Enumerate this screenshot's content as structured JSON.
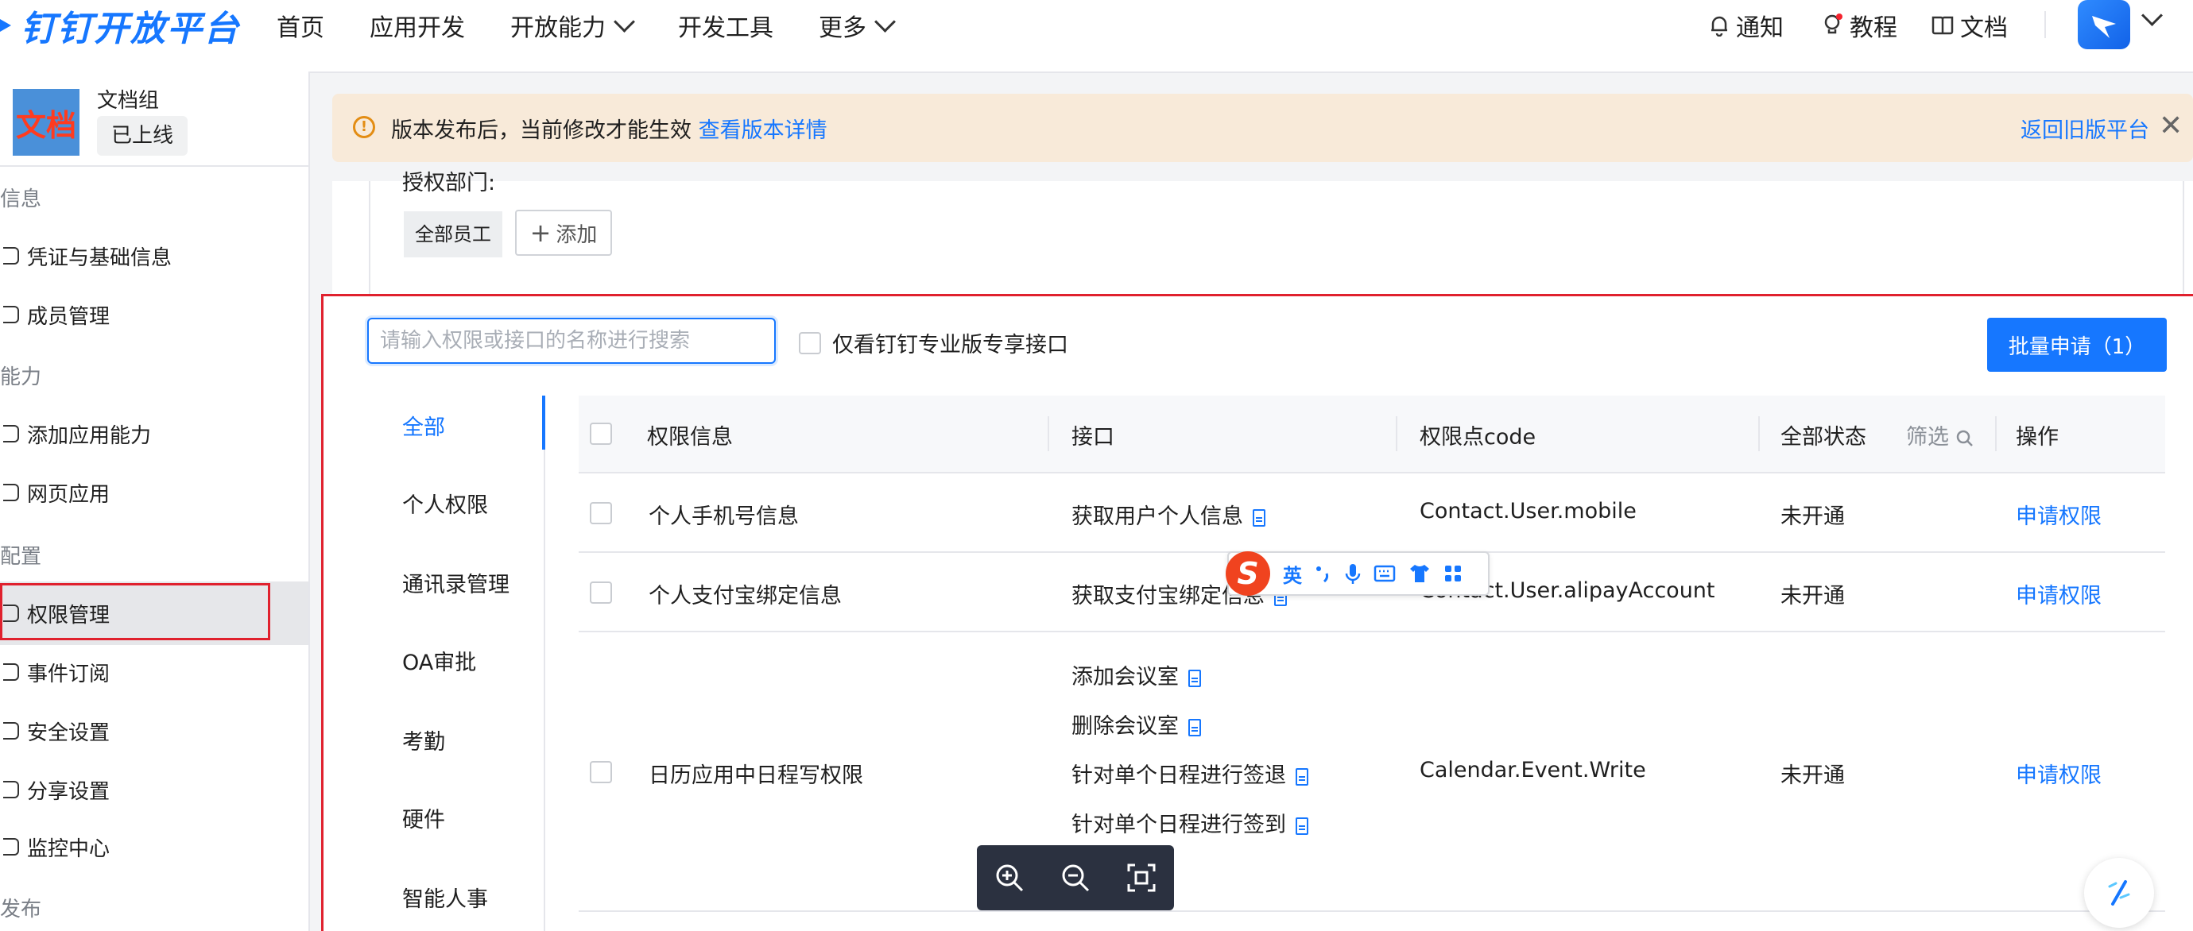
{
  "brand": {
    "title": "钉钉开放平台"
  },
  "topnav": {
    "items": [
      "首页",
      "应用开发",
      "开放能力",
      "开发工具",
      "更多"
    ],
    "right": [
      "通知",
      "教程",
      "文档"
    ]
  },
  "sidebar": {
    "app_icon_text": "文档",
    "app_name": "文档组",
    "status": "已上线",
    "groups": [
      "信息",
      "能力",
      "配置",
      "发布"
    ],
    "items": [
      "凭证与基础信息",
      "成员管理",
      "添加应用能力",
      "网页应用",
      "权限管理",
      "事件订阅",
      "安全设置",
      "分享设置",
      "监控中心"
    ]
  },
  "notice": {
    "text": "版本发布后，当前修改才能生效",
    "link": "查看版本详情",
    "back": "返回旧版平台",
    "close": "✕"
  },
  "dept": {
    "label": "授权部门:",
    "chip": "全部员工",
    "add": "添加"
  },
  "toolbar": {
    "search_placeholder": "请输入权限或接口的名称进行搜索",
    "only_pro": "仅看钉钉专业版专享接口",
    "batch": "批量申请（1）"
  },
  "categories": [
    "全部",
    "个人权限",
    "通讯录管理",
    "OA审批",
    "考勤",
    "硬件",
    "智能人事"
  ],
  "table": {
    "headers": {
      "info": "权限信息",
      "api": "接口",
      "code": "权限点code",
      "status": "全部状态",
      "filter": "筛选",
      "action": "操作"
    },
    "rows": [
      {
        "info": "个人手机号信息",
        "apis": [
          "获取用户个人信息"
        ],
        "code": "Contact.User.mobile",
        "status": "未开通",
        "action": "申请权限"
      },
      {
        "info": "个人支付宝绑定信息",
        "apis": [
          "获取支付宝绑定信息"
        ],
        "code": "Contact.User.alipayAccount",
        "status": "未开通",
        "action": "申请权限"
      },
      {
        "info": "日历应用中日程写权限",
        "apis": [
          "添加会议室",
          "删除会议室",
          "针对单个日程进行签退",
          "针对单个日程进行签到"
        ],
        "code": "Calendar.Event.Write",
        "status": "未开通",
        "action": "申请权限"
      }
    ]
  },
  "ime": {
    "lang": "英",
    "logo": "S"
  }
}
